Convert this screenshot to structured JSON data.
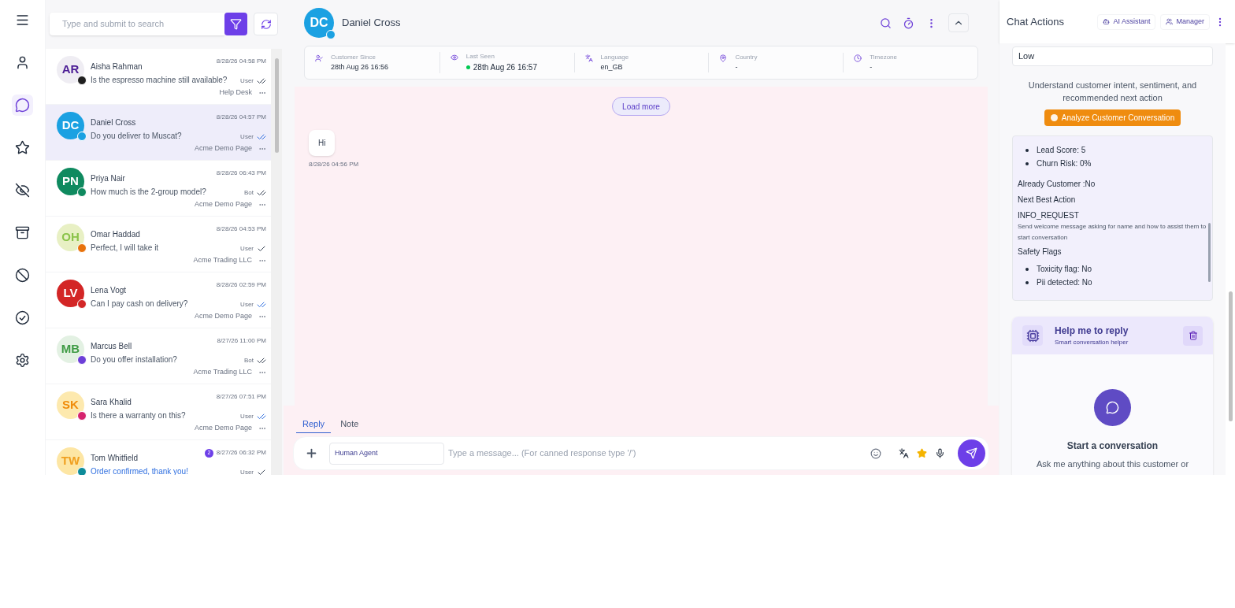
{
  "nav": [
    {
      "selected": false
    },
    {
      "selected": false
    },
    {
      "selected": true
    },
    {
      "selected": false
    },
    {
      "selected": false
    },
    {
      "selected": false
    },
    {
      "selected": false
    },
    {
      "selected": false
    },
    {
      "selected": false
    }
  ],
  "search": {
    "placeholder": "Type and submit to search"
  },
  "conversations": [
    {
      "initials": "AR",
      "name": "Aisha Rahman",
      "message": "Is the espresso machine still available?",
      "time": "8/28/26 04:58 PM",
      "sender": "User",
      "double_tick": true,
      "read": false,
      "source": "Help Desk",
      "color": "#1f1f1f",
      "selected": false
    },
    {
      "initials": "DC",
      "name": "Daniel Cross",
      "message": "Do you deliver to Muscat?",
      "time": "8/28/26 04:57 PM",
      "sender": "User",
      "double_tick": true,
      "read": true,
      "source": "Acme Demo Page",
      "color": "#1ba1e2",
      "selected": true
    },
    {
      "initials": "PN",
      "name": "Priya Nair",
      "message": "How much is the 2-group model?",
      "time": "8/28/26 06:43 PM",
      "sender": "Bot",
      "double_tick": true,
      "read": false,
      "source": "Acme Demo Page",
      "color": "#0f8a5f",
      "selected": false
    },
    {
      "initials": "OH",
      "name": "Omar Haddad",
      "message": "Perfect, I will take it",
      "time": "8/28/26 04:53 PM",
      "sender": "User",
      "double_tick": false,
      "read": false,
      "source": "Acme Trading LLC",
      "color": "#e8720c",
      "selected": false
    },
    {
      "initials": "LV",
      "name": "Lena Vogt",
      "message": "Can I pay cash on delivery?",
      "time": "8/28/26 02:59 PM",
      "sender": "User",
      "double_tick": true,
      "read": true,
      "source": "Acme Demo Page",
      "color": "#d32626",
      "selected": false
    },
    {
      "initials": "MB",
      "name": "Marcus Bell",
      "message": "Do you offer installation?",
      "time": "8/27/26 11:00 PM",
      "sender": "Bot",
      "double_tick": true,
      "read": false,
      "source": "Acme Trading LLC",
      "color": "#6d3fd8",
      "selected": false
    },
    {
      "initials": "SK",
      "name": "Sara Khalid",
      "message": "Is there a warranty on this?",
      "time": "8/27/26 07:51 PM",
      "sender": "User",
      "double_tick": true,
      "read": true,
      "source": "Acme Demo Page",
      "color": "#d6246e",
      "selected": false
    },
    {
      "initials": "TW",
      "name": "Tom Whitfield",
      "message": "Order confirmed, thank you!",
      "time": "8/27/26 06:32 PM",
      "sender": "User",
      "double_tick": false,
      "read": false,
      "unread": "2",
      "color": "#0e8c9a",
      "selected": false
    }
  ],
  "chat": {
    "initials": "DC",
    "name": "Daniel Cross",
    "info": [
      {
        "label": "Customer Since",
        "value": "28th Aug 26 16:56",
        "online": false
      },
      {
        "label": "Last Seen",
        "value": "28th Aug 26 16:57",
        "online": true
      },
      {
        "label": "Language",
        "value": "en_GB",
        "online": false
      },
      {
        "label": "Country",
        "value": "-",
        "online": false
      },
      {
        "label": "Timezone",
        "value": "-",
        "online": false
      }
    ],
    "load_more": "Load more",
    "messages": [
      {
        "text": "Hi",
        "time": "8/28/26 04:56 PM"
      }
    ],
    "tabs": [
      {
        "label": "Reply",
        "selected": true
      },
      {
        "label": "Note",
        "selected": false
      }
    ],
    "agent": "Human Agent",
    "placeholder": "Type a message... (For canned response type '/')"
  },
  "actions": {
    "title": "Chat Actions",
    "buttons": [
      {
        "label": "AI Assistant"
      },
      {
        "label": "Manager"
      }
    ],
    "priority": "Low",
    "intro": "Understand customer intent, sentiment, and recommended next action",
    "analyze": "Analyze Customer Conversation",
    "scores": [
      "Lead Score: 5",
      "Churn Risk: 0%"
    ],
    "already_customer": "Already Customer :No",
    "next_heading": "Next Best Action",
    "next_action": "INFO_REQUEST",
    "next_description": "Send welcome message asking for name and how to assist them to start conversation",
    "safety_heading": "Safety Flags",
    "safety": [
      "Toxicity flag: No",
      "Pii detected: No"
    ],
    "helper": {
      "title": "Help me to reply",
      "subtitle": "Smart conversation helper",
      "empty_title": "Start a conversation",
      "empty_text": "Ask me anything about this customer or"
    }
  }
}
